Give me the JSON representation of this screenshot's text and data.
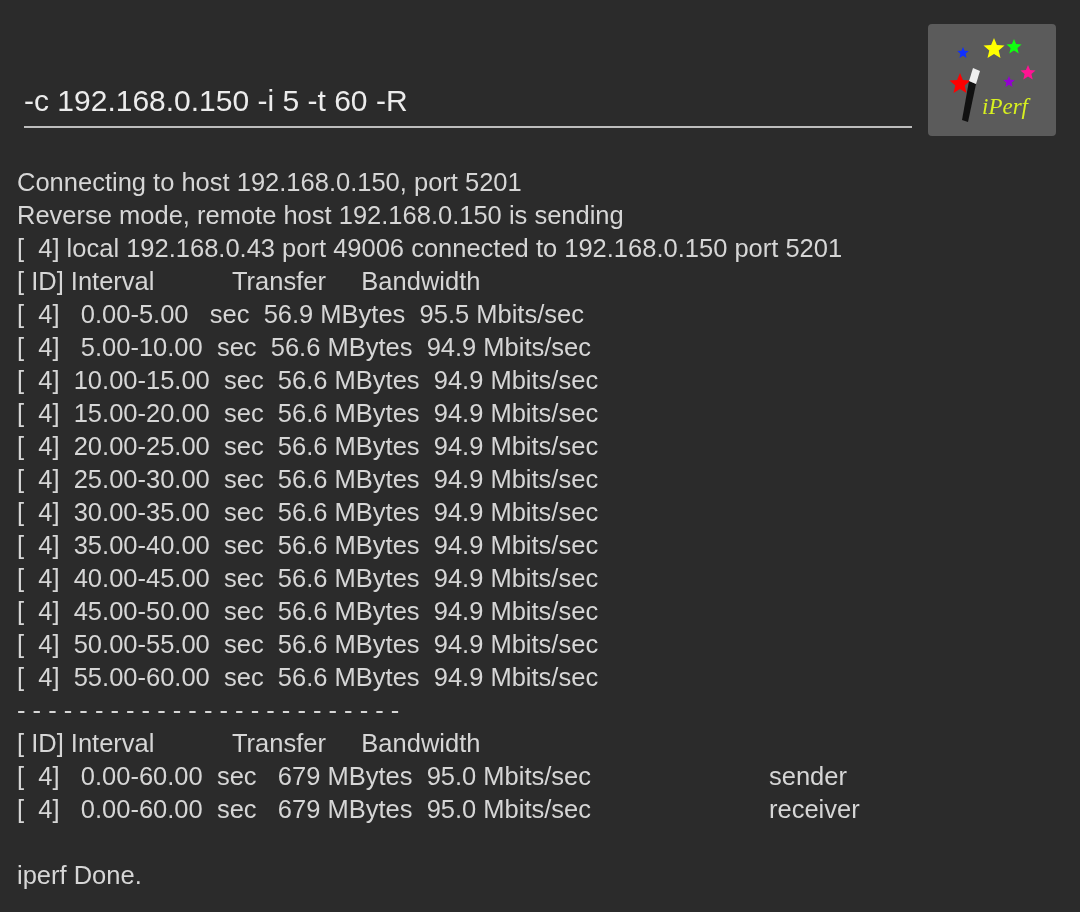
{
  "command_field": {
    "value": "-c 192.168.0.150 -i 5 -t 60 -R"
  },
  "logo_button": {
    "label": "iPerf"
  },
  "output": [
    {
      "text": "Connecting to host 192.168.0.150, port 5201"
    },
    {
      "text": "Reverse mode, remote host 192.168.0.150 is sending"
    },
    {
      "text": "[  4] local 192.168.0.43 port 49006 connected to 192.168.0.150 port 5201"
    },
    {
      "text": "[ ID] Interval           Transfer     Bandwidth"
    },
    {
      "text": "[  4]   0.00-5.00   sec  56.9 MBytes  95.5 Mbits/sec"
    },
    {
      "text": "[  4]   5.00-10.00  sec  56.6 MBytes  94.9 Mbits/sec"
    },
    {
      "text": "[  4]  10.00-15.00  sec  56.6 MBytes  94.9 Mbits/sec"
    },
    {
      "text": "[  4]  15.00-20.00  sec  56.6 MBytes  94.9 Mbits/sec"
    },
    {
      "text": "[  4]  20.00-25.00  sec  56.6 MBytes  94.9 Mbits/sec"
    },
    {
      "text": "[  4]  25.00-30.00  sec  56.6 MBytes  94.9 Mbits/sec"
    },
    {
      "text": "[  4]  30.00-35.00  sec  56.6 MBytes  94.9 Mbits/sec"
    },
    {
      "text": "[  4]  35.00-40.00  sec  56.6 MBytes  94.9 Mbits/sec"
    },
    {
      "text": "[  4]  40.00-45.00  sec  56.6 MBytes  94.9 Mbits/sec"
    },
    {
      "text": "[  4]  45.00-50.00  sec  56.6 MBytes  94.9 Mbits/sec"
    },
    {
      "text": "[  4]  50.00-55.00  sec  56.6 MBytes  94.9 Mbits/sec"
    },
    {
      "text": "[  4]  55.00-60.00  sec  56.6 MBytes  94.9 Mbits/sec"
    },
    {
      "text": "- - - - - - - - - - - - - - - - - - - - - - - - -"
    },
    {
      "text": "[ ID] Interval           Transfer     Bandwidth"
    },
    {
      "text": "[  4]   0.00-60.00  sec   679 MBytes  95.0 Mbits/sec",
      "role": "sender"
    },
    {
      "text": "[  4]   0.00-60.00  sec   679 MBytes  95.0 Mbits/sec",
      "role": "receiver"
    }
  ],
  "status": "iperf Done."
}
